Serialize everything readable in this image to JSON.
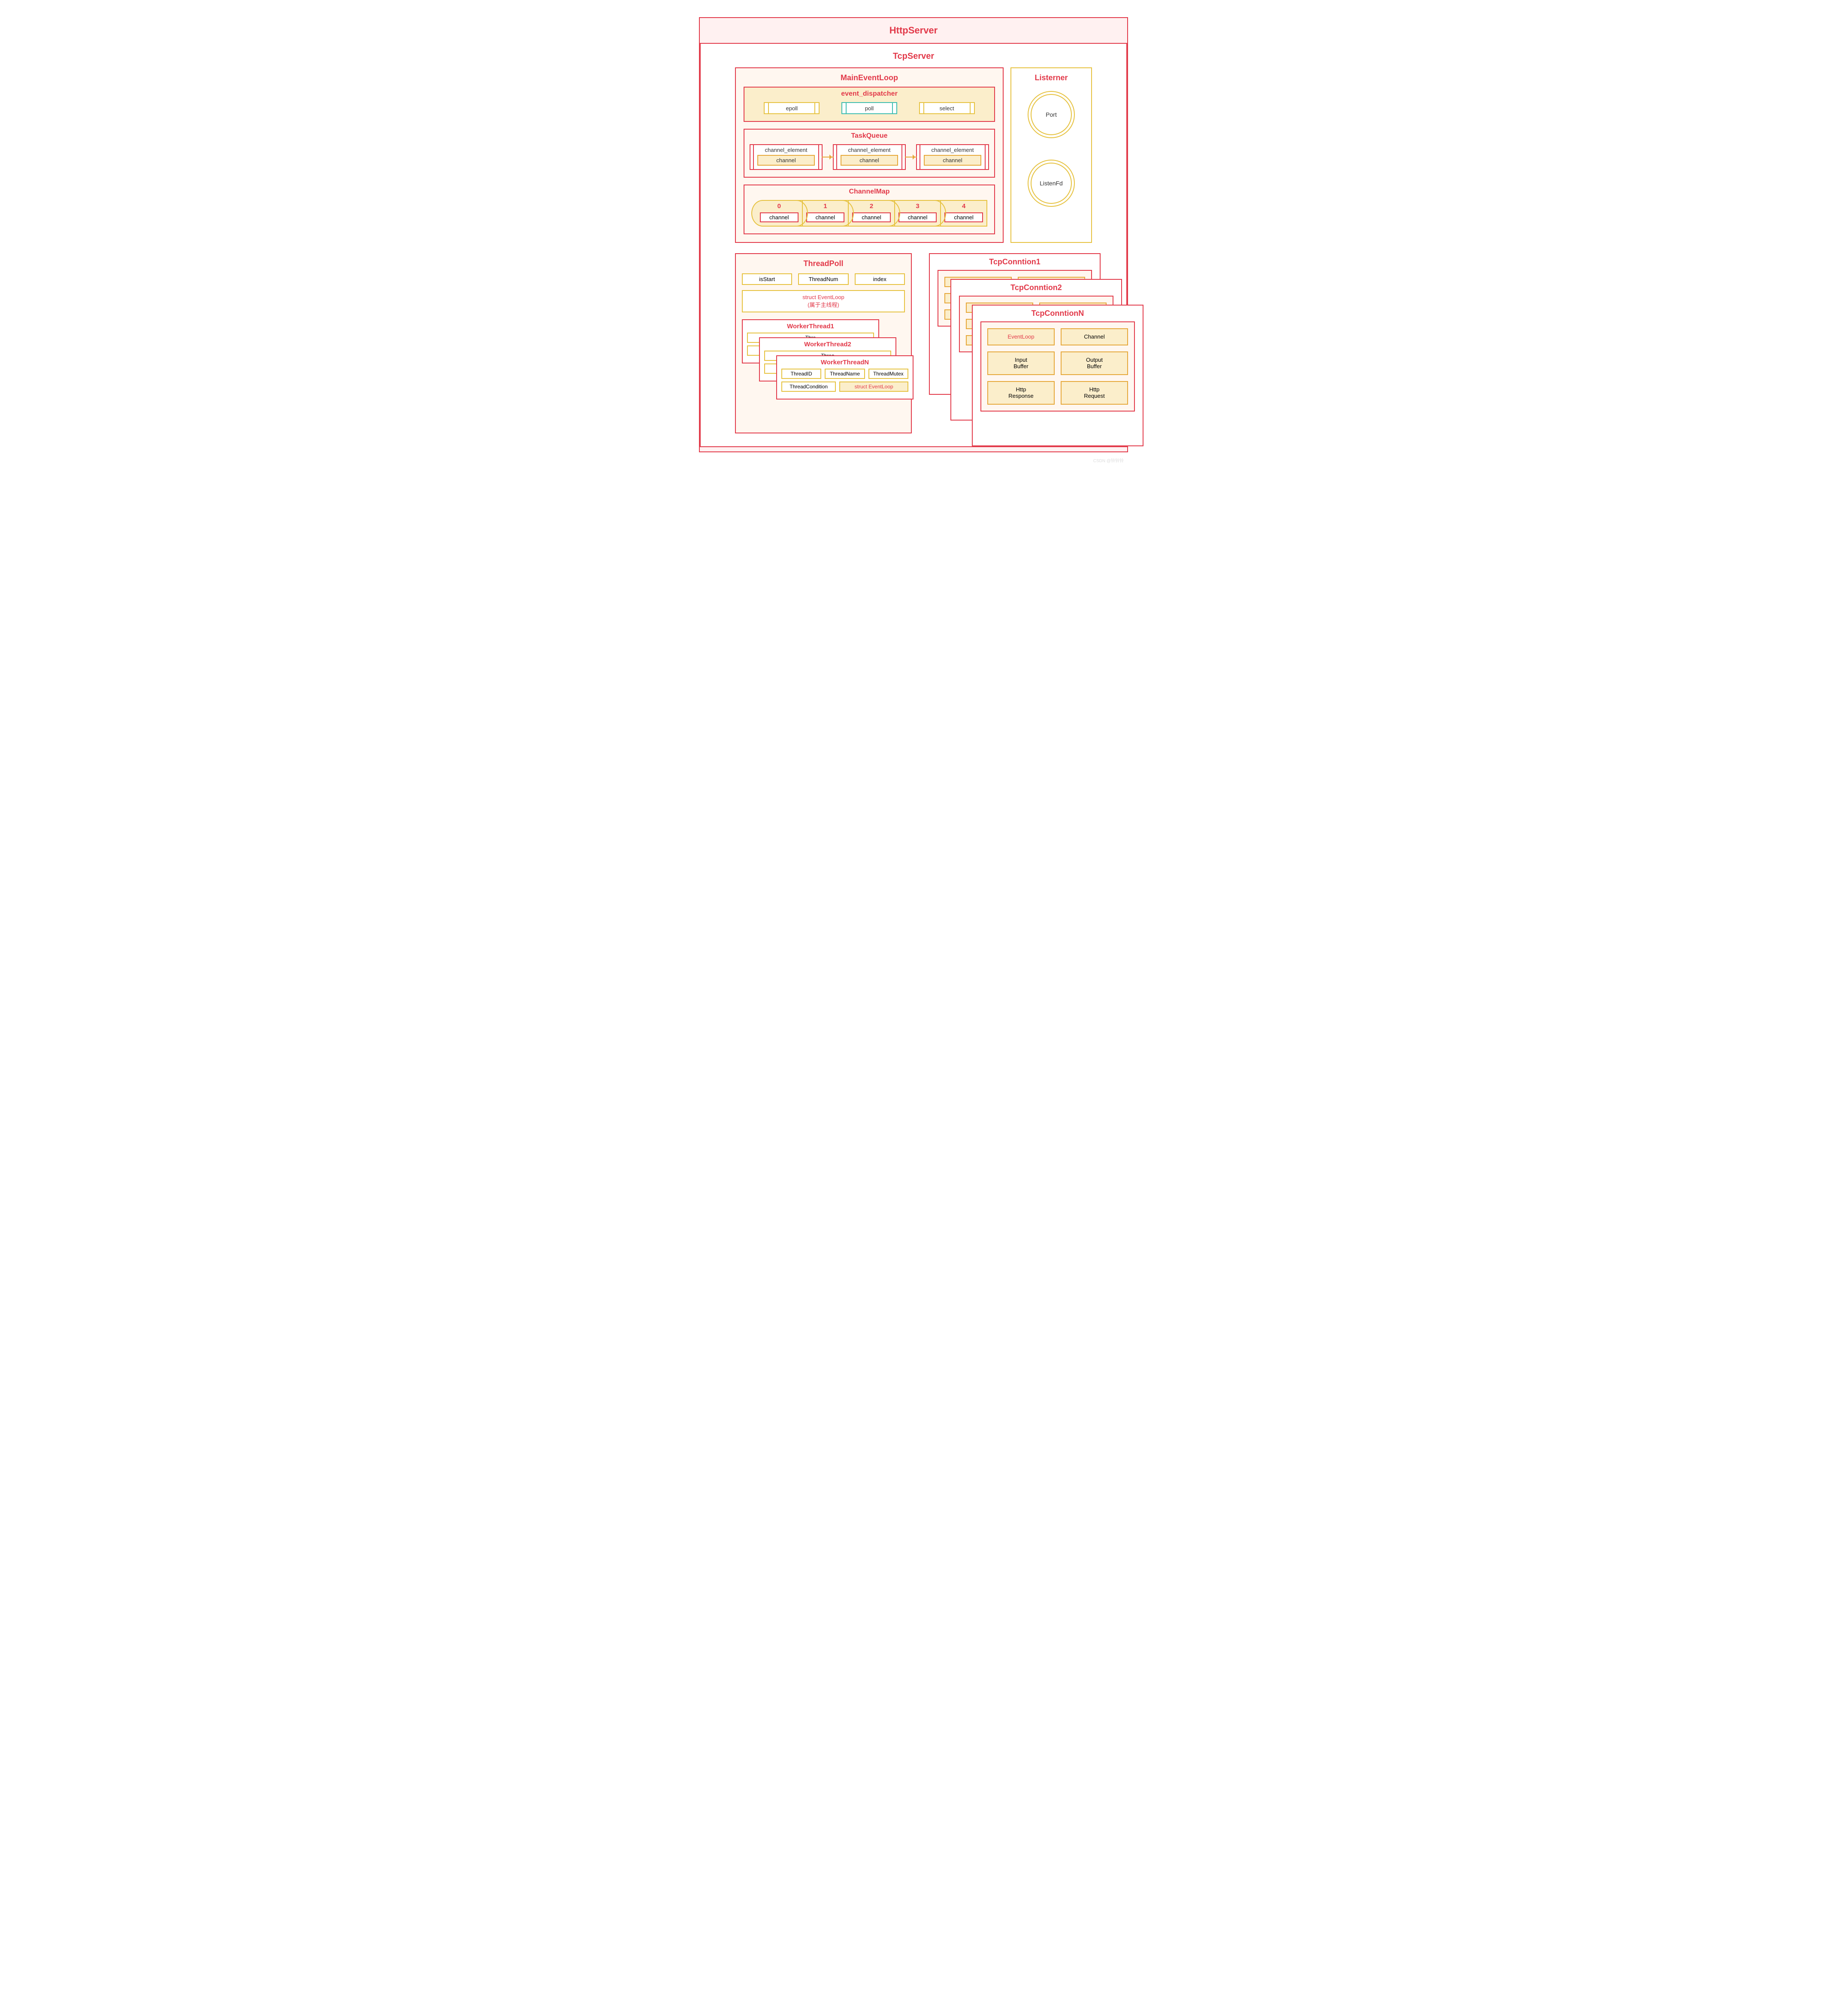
{
  "http_server": {
    "title": "HttpServer"
  },
  "tcp_server": {
    "title": "TcpServer"
  },
  "listener": {
    "title": "Listerner",
    "circles": [
      "Port",
      "ListenFd"
    ]
  },
  "main_event_loop": {
    "title": "MainEventLoop",
    "event_dispatcher": {
      "title": "event_dispatcher",
      "items": [
        "epoll",
        "poll",
        "select"
      ]
    },
    "task_queue": {
      "title": "TaskQueue",
      "element_label": "channel_element",
      "channel_label": "channel"
    },
    "channel_map": {
      "title": "ChannelMap",
      "indices": [
        "0",
        "1",
        "2",
        "3",
        "4"
      ],
      "channel_label": "channel"
    }
  },
  "thread_pool": {
    "title": "ThreadPoll",
    "props": [
      "isStart",
      "ThreadNum",
      "index"
    ],
    "struct_line1": "struct EventLoop",
    "struct_line2": "(属于主线程)",
    "workers": {
      "titles": [
        "WorkerThread1",
        "WorkerThread2",
        "WorkerThreadN"
      ],
      "fields": [
        "ThreadID",
        "ThreadName",
        "ThreadMutex",
        "ThreadCondition"
      ],
      "evloop": "struct EventLoop",
      "trunc1": "Thre",
      "trunc2": "Threa"
    }
  },
  "tcp_conn": {
    "titles": [
      "TcpConntion1",
      "TcpConntion2",
      "TcpConntionN"
    ],
    "items": [
      {
        "label": "EventLoop",
        "red": true
      },
      {
        "label": "Channel",
        "red": false
      },
      {
        "label": "Input\nBuffer",
        "red": false
      },
      {
        "label": "Output\nBuffer",
        "red": false
      },
      {
        "label": "Http\nResponse",
        "red": false
      },
      {
        "label": "Http\nRequest",
        "red": false
      }
    ]
  },
  "watermark": "CSDN @铃铃铃"
}
